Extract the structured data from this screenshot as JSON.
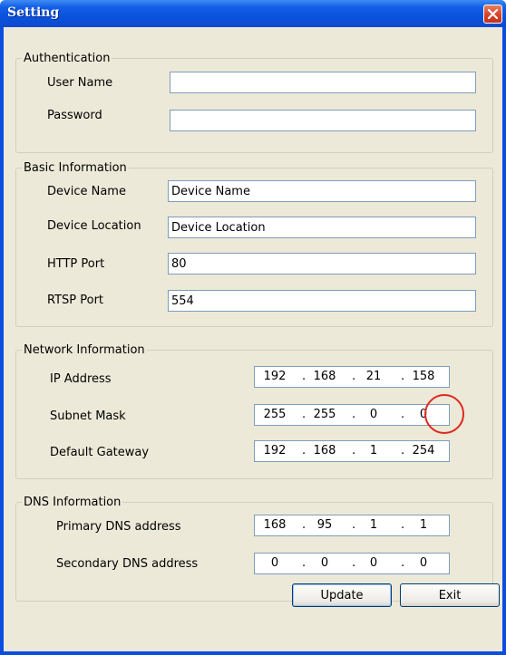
{
  "window": {
    "title": "Setting",
    "close_icon": "close-icon"
  },
  "authentication": {
    "legend": "Authentication",
    "user_name_label": "User Name",
    "user_name_value": "",
    "password_label": "Password",
    "password_value": ""
  },
  "basic": {
    "legend": "Basic Information",
    "device_name_label": "Device Name",
    "device_name_value": "Device Name",
    "device_location_label": "Device Location",
    "device_location_value": "Device Location",
    "http_port_label": "HTTP Port",
    "http_port_value": "80",
    "rtsp_port_label": "RTSP Port",
    "rtsp_port_value": "554"
  },
  "network": {
    "legend": "Network Information",
    "ip_label": "IP Address",
    "ip": [
      "192",
      "168",
      "21",
      "158"
    ],
    "mask_label": "Subnet Mask",
    "mask": [
      "255",
      "255",
      "0",
      "0"
    ],
    "gateway_label": "Default Gateway",
    "gateway": [
      "192",
      "168",
      "1",
      "254"
    ]
  },
  "dns": {
    "legend": "DNS Information",
    "primary_label": "Primary DNS address",
    "primary": [
      "168",
      "95",
      "1",
      "1"
    ],
    "secondary_label": "Secondary DNS address",
    "secondary": [
      "0",
      "0",
      "0",
      "0"
    ]
  },
  "buttons": {
    "update_label": "Update",
    "exit_label": "Exit"
  },
  "dot": ".",
  "colors": {
    "titlebar": "#0a52dc",
    "client": "#ece9d8",
    "annotation": "#e0281f"
  }
}
